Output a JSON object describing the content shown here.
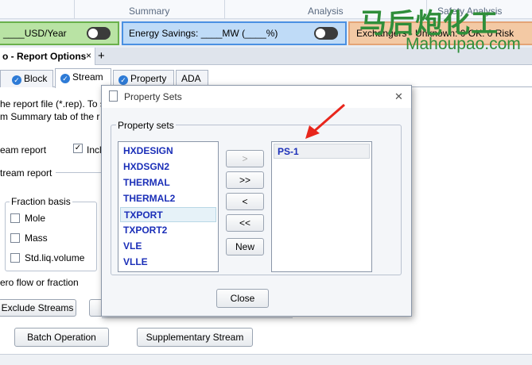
{
  "ribbon": {
    "groups": [
      "Summary",
      "Analysis",
      "Safety Analysis"
    ]
  },
  "status": {
    "cost_text": "____USD/Year",
    "energy_text": "Energy Savings: ____MW   (____%)",
    "exchangers_text": "Exchangers -  Unknown: 0   OK: 0   Risk"
  },
  "doc_tab": {
    "title": "o - Report Options",
    "close": "×",
    "add": "+"
  },
  "tabs": [
    "Block",
    "Stream",
    "Property",
    "ADA"
  ],
  "background": {
    "line1": "he report file (*.rep). To s",
    "line2": "m Summary tab of the r",
    "stream_report": "eam report",
    "include_label": "Incl",
    "stream_report_section": "tream report",
    "fraction_basis": "Fraction basis",
    "mole": "Mole",
    "mass": "Mass",
    "stdliq": "Std.liq.volume",
    "zero_flow": "ero flow or fraction",
    "exclude_streams": "Exclude Streams",
    "batch_operation": "Batch Operation",
    "supplementary_stream": "Supplementary Stream"
  },
  "dialog": {
    "title": "Property Sets",
    "close": "✕",
    "group_label": "Property sets",
    "available": [
      "HXDESIGN",
      "HXDSGN2",
      "THERMAL",
      "THERMAL2",
      "TXPORT",
      "TXPORT2",
      "VLE",
      "VLLE"
    ],
    "selected_available": "TXPORT",
    "selected": [
      "PS-1"
    ],
    "buttons": {
      "add": ">",
      "add_all": ">>",
      "remove": "<",
      "remove_all": "<<",
      "new": "New"
    },
    "close_button": "Close"
  },
  "watermark": {
    "cn": "马后炮化工",
    "url": "Mahoupao.com"
  },
  "colors": {
    "green_panel": "#b9e3a4",
    "blue_panel": "#bfdbf7",
    "orange_panel": "#f3c9a4",
    "arrow": "#e8261c"
  }
}
